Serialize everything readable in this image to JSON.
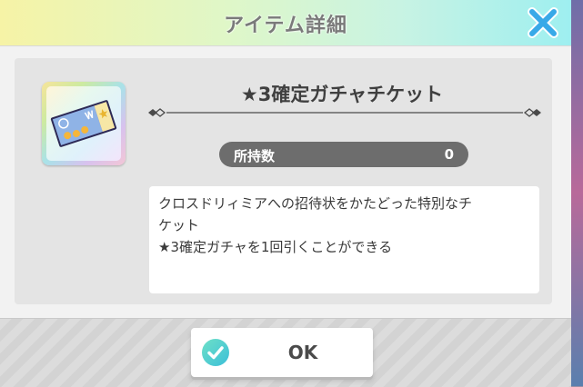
{
  "dialog": {
    "title": "アイテム詳細",
    "close_icon": "close-x-icon",
    "accent_color": "#38a9e8"
  },
  "item": {
    "name": "★3確定ガチャチケット",
    "icon": "gacha-ticket-icon",
    "owned_label": "所持数",
    "owned_count": "0",
    "description_lines": [
      "クロスドリィミアへの招待状をかたどった特別なチ",
      "ケット",
      "★3確定ガチャを1回引くことができる"
    ]
  },
  "footer": {
    "ok_label": "OK",
    "ok_icon": "check-circle-icon"
  }
}
